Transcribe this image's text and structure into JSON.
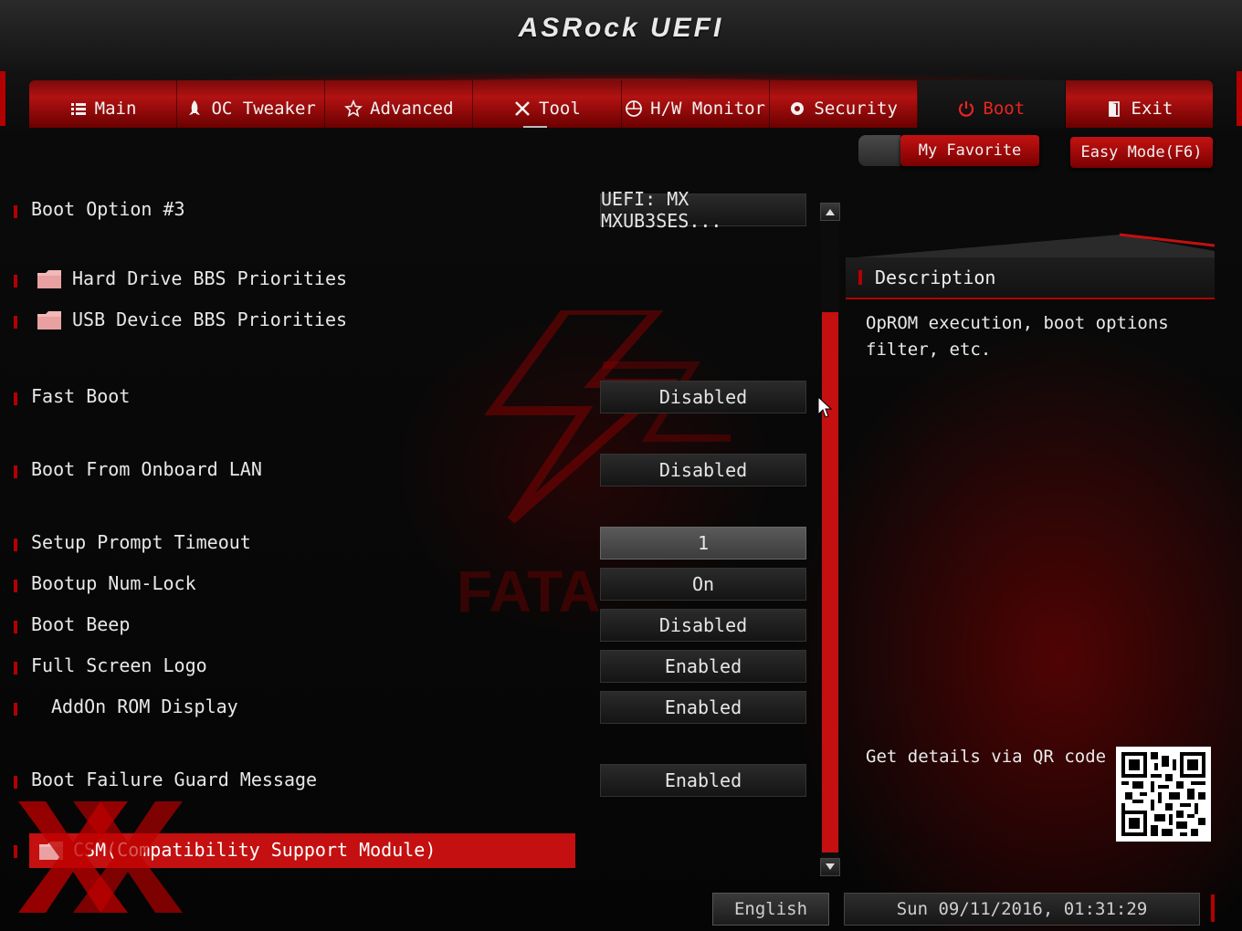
{
  "header": {
    "brand": "ASRock UEFI"
  },
  "tabs": [
    {
      "label": "Main",
      "icon": "list-icon",
      "active": false
    },
    {
      "label": "OC Tweaker",
      "icon": "rocket-icon",
      "active": false
    },
    {
      "label": "Advanced",
      "icon": "star-icon",
      "active": false
    },
    {
      "label": "Tool",
      "icon": "tools-icon",
      "active": false
    },
    {
      "label": "H/W Monitor",
      "icon": "monitor-icon",
      "active": false
    },
    {
      "label": "Security",
      "icon": "shield-gear-icon",
      "active": false
    },
    {
      "label": "Boot",
      "icon": "power-icon",
      "active": true
    },
    {
      "label": "Exit",
      "icon": "door-icon",
      "active": false
    }
  ],
  "toolbar": {
    "favorite": "My Favorite",
    "easy_mode": "Easy Mode(F6)"
  },
  "settings": {
    "boot_option_3": {
      "label": "Boot Option #3",
      "value": "UEFI: MX MXUB3SES..."
    },
    "hdd_bbs": {
      "label": "Hard Drive BBS Priorities"
    },
    "usb_bbs": {
      "label": "USB Device BBS Priorities"
    },
    "fast_boot": {
      "label": "Fast Boot",
      "value": "Disabled"
    },
    "onboard_lan": {
      "label": "Boot From Onboard LAN",
      "value": "Disabled"
    },
    "prompt_timeout": {
      "label": "Setup Prompt Timeout",
      "value": "1"
    },
    "num_lock": {
      "label": "Bootup Num-Lock",
      "value": "On"
    },
    "boot_beep": {
      "label": "Boot Beep",
      "value": "Disabled"
    },
    "full_logo": {
      "label": "Full Screen Logo",
      "value": "Enabled"
    },
    "addon_rom": {
      "label": "AddOn ROM Display",
      "value": "Enabled"
    },
    "guard_msg": {
      "label": "Boot Failure Guard Message",
      "value": "Enabled"
    },
    "csm": {
      "label": "CSM(Compatibility Support Module)"
    }
  },
  "description": {
    "title": "Description",
    "text": "OpROM execution, boot options filter, etc.",
    "qr_label": "Get details via QR code"
  },
  "footer": {
    "language": "English",
    "datetime": "Sun 09/11/2016, 01:31:29"
  },
  "colors": {
    "accent": "#c41010",
    "background": "#050505"
  }
}
